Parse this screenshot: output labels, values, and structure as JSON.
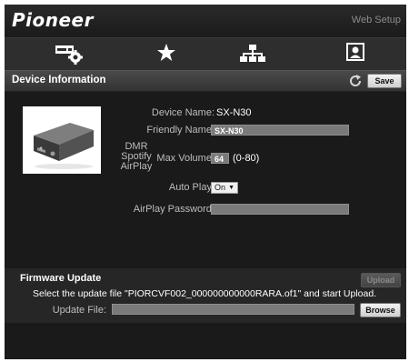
{
  "app": {
    "logo": "Pioneer",
    "header_right": "Web Setup"
  },
  "tabs": [
    {
      "icon": "device-settings-icon",
      "active": true
    },
    {
      "icon": "star-icon",
      "active": false
    },
    {
      "icon": "network-icon",
      "active": false
    },
    {
      "icon": "profile-icon",
      "active": false
    }
  ],
  "device_info": {
    "title": "Device Information",
    "save_label": "Save",
    "device_name_label": "Device Name:",
    "device_name_value": "SX-N30",
    "friendly_name_label": "Friendly Name:",
    "friendly_name_value": "SX-N30",
    "max_volume_prefix": "DMR\nSpotify\nAirPlay",
    "max_volume_label": "Max Volume:",
    "max_volume_value": "64",
    "max_volume_range": "(0-80)",
    "auto_play_label": "Auto Play:",
    "auto_play_value": "On",
    "airplay_password_label": "AirPlay Password:",
    "airplay_password_value": ""
  },
  "firmware": {
    "title": "Firmware Update",
    "upload_label": "Upload",
    "instruction": "Select the update file \"PIORCVF002_000000000000RARA.of1\" and start Upload.",
    "update_file_label": "Update File:",
    "update_file_value": "",
    "browse_label": "Browse"
  }
}
